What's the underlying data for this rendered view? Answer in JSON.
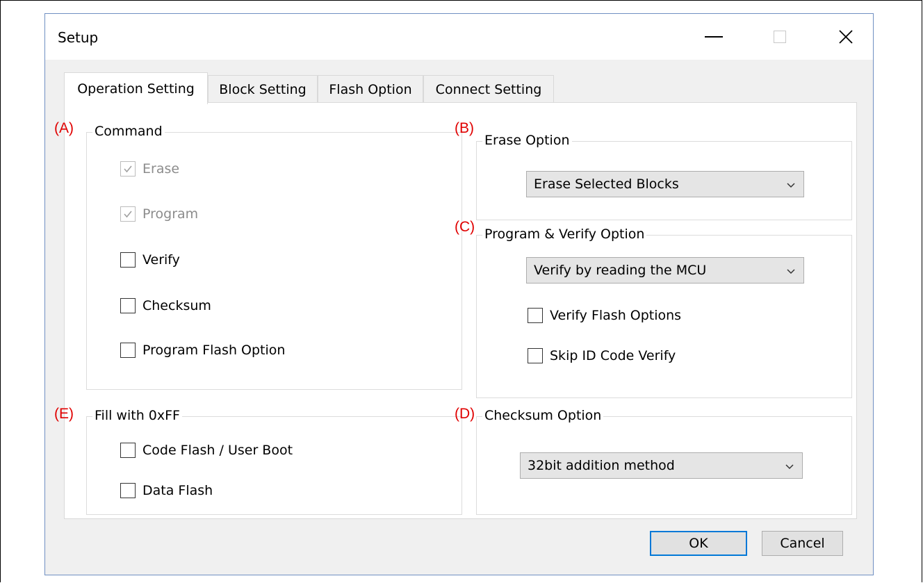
{
  "window": {
    "title": "Setup",
    "controls": {
      "minimize": "minimize-icon",
      "maximize": "maximize-icon",
      "close": "close-icon"
    }
  },
  "tabs": [
    {
      "label": "Operation Setting",
      "active": true
    },
    {
      "label": "Block Setting",
      "active": false
    },
    {
      "label": "Flash Option",
      "active": false
    },
    {
      "label": "Connect Setting",
      "active": false
    }
  ],
  "command": {
    "marker": "(A)",
    "title": "Command",
    "items": [
      {
        "label": "Erase",
        "checked": true,
        "disabled": true
      },
      {
        "label": "Program",
        "checked": true,
        "disabled": true
      },
      {
        "label": "Verify",
        "checked": false,
        "disabled": false
      },
      {
        "label": "Checksum",
        "checked": false,
        "disabled": false
      },
      {
        "label": "Program Flash Option",
        "checked": false,
        "disabled": false
      }
    ]
  },
  "erase_option": {
    "marker": "(B)",
    "title": "Erase Option",
    "selected": "Erase Selected Blocks"
  },
  "program_verify": {
    "marker": "(C)",
    "title": "Program & Verify Option",
    "selected": "Verify by reading the MCU",
    "items": [
      {
        "label": "Verify Flash Options",
        "checked": false
      },
      {
        "label": "Skip ID Code Verify",
        "checked": false
      }
    ]
  },
  "fill": {
    "marker": "(E)",
    "title": "Fill with 0xFF",
    "items": [
      {
        "label": "Code Flash / User Boot",
        "checked": false
      },
      {
        "label": "Data Flash",
        "checked": false
      }
    ]
  },
  "checksum_option": {
    "marker": "(D)",
    "title": "Checksum Option",
    "selected": "32bit addition method"
  },
  "buttons": {
    "ok": "OK",
    "cancel": "Cancel"
  },
  "colors": {
    "marker": "#e00000",
    "accent": "#0078d7",
    "window_border": "#6f8fc2"
  }
}
